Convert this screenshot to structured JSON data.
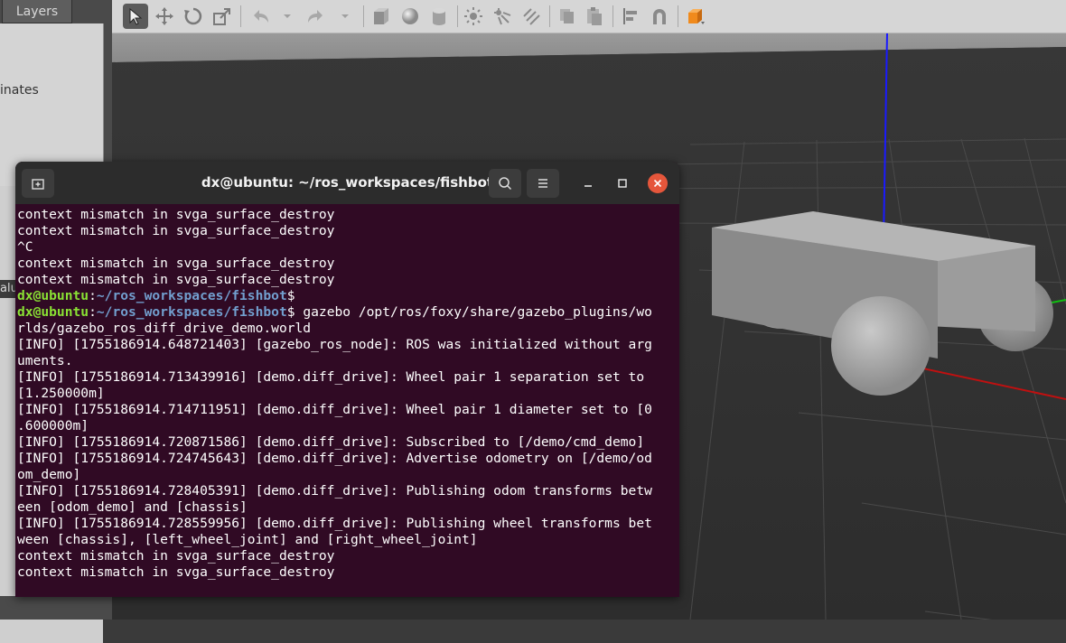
{
  "gazebo": {
    "tabs": {
      "layers": "Layers"
    },
    "left_panel": {
      "coordinates_fragment": "inates",
      "value_fragment": "alu"
    },
    "toolbar": {
      "tools": [
        "select",
        "translate",
        "rotate",
        "scale",
        "undo",
        "undo-history",
        "redo",
        "redo-history",
        "box",
        "sphere",
        "cylinder",
        "point-light",
        "spot-light",
        "directional-light",
        "copy",
        "paste",
        "align",
        "magnet",
        "view-angle"
      ]
    }
  },
  "terminal": {
    "title": "dx@ubuntu: ~/ros_workspaces/fishbot",
    "lines": [
      {
        "text": "context mismatch in svga_surface_destroy"
      },
      {
        "text": "context mismatch in svga_surface_destroy"
      },
      {
        "text": "^C"
      },
      {
        "text": "context mismatch in svga_surface_destroy"
      },
      {
        "text": "context mismatch in svga_surface_destroy"
      },
      {
        "user": "dx@ubuntu",
        "colon": ":",
        "path": "~/ros_workspaces/fishbot",
        "dollar": "$",
        "text": ""
      },
      {
        "user": "dx@ubuntu",
        "colon": ":",
        "path": "~/ros_workspaces/fishbot",
        "dollar": "$",
        "text": " gazebo /opt/ros/foxy/share/gazebo_plugins/wo"
      },
      {
        "text": "rlds/gazebo_ros_diff_drive_demo.world"
      },
      {
        "text": "[INFO] [1755186914.648721403] [gazebo_ros_node]: ROS was initialized without arg"
      },
      {
        "text": "uments."
      },
      {
        "text": "[INFO] [1755186914.713439916] [demo.diff_drive]: Wheel pair 1 separation set to"
      },
      {
        "text": "[1.250000m]"
      },
      {
        "text": "[INFO] [1755186914.714711951] [demo.diff_drive]: Wheel pair 1 diameter set to [0"
      },
      {
        "text": ".600000m]"
      },
      {
        "text": "[INFO] [1755186914.720871586] [demo.diff_drive]: Subscribed to [/demo/cmd_demo]"
      },
      {
        "text": "[INFO] [1755186914.724745643] [demo.diff_drive]: Advertise odometry on [/demo/od"
      },
      {
        "text": "om_demo]"
      },
      {
        "text": "[INFO] [1755186914.728405391] [demo.diff_drive]: Publishing odom transforms betw"
      },
      {
        "text": "een [odom_demo] and [chassis]"
      },
      {
        "text": "[INFO] [1755186914.728559956] [demo.diff_drive]: Publishing wheel transforms bet"
      },
      {
        "text": "ween [chassis], [left_wheel_joint] and [right_wheel_joint]"
      },
      {
        "text": "context mismatch in svga_surface_destroy"
      },
      {
        "text": "context mismatch in svga_surface_destroy"
      }
    ]
  },
  "colors": {
    "terminal_bg": "#300a24",
    "prompt_user": "#8ae234",
    "prompt_path": "#729fcf",
    "close_button": "#e5563b",
    "axis_z": "#1a1aff",
    "axis_x": "#c01010",
    "axis_y": "#10c010"
  }
}
